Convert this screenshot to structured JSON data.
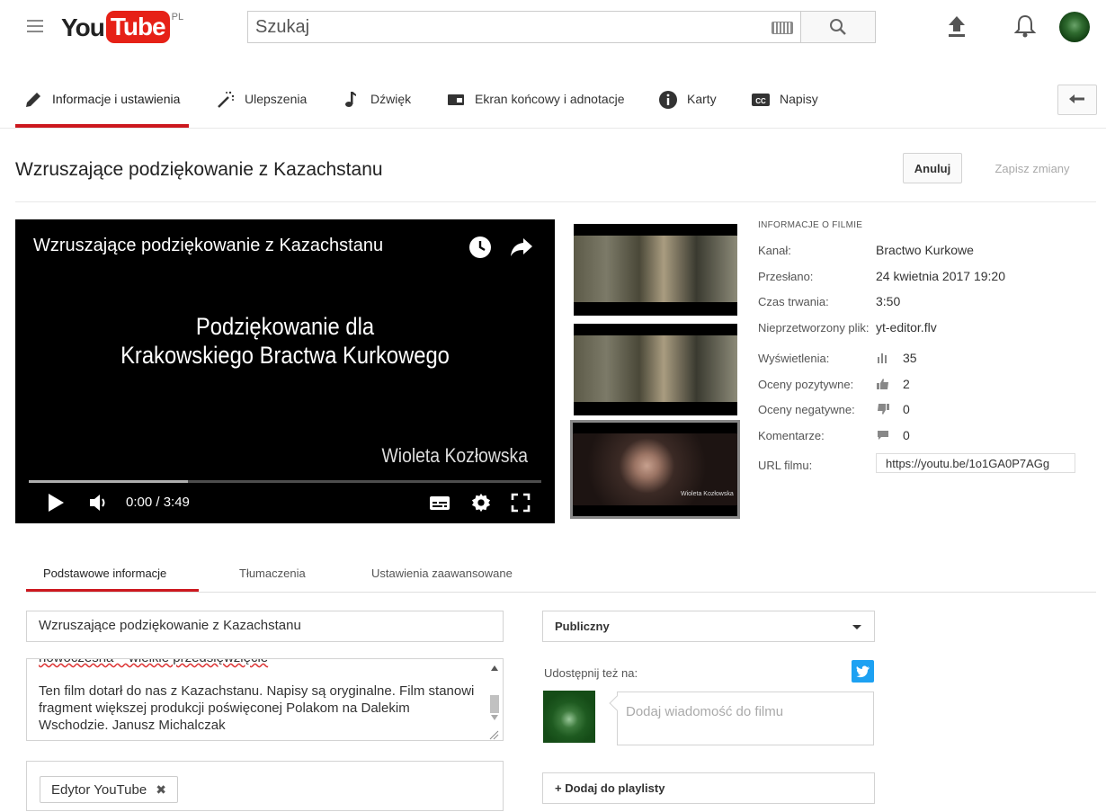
{
  "masthead": {
    "logo_you": "You",
    "logo_tube": "Tube",
    "country_code": "PL",
    "search_placeholder": "Szukaj",
    "brand_color": "#e62117"
  },
  "editor_tabs": [
    {
      "label": "Informacje i ustawienia",
      "icon": "pencil-icon",
      "active": true
    },
    {
      "label": "Ulepszenia",
      "icon": "magic-wand-icon"
    },
    {
      "label": "Dźwięk",
      "icon": "music-note-icon"
    },
    {
      "label": "Ekran końcowy i adnotacje",
      "icon": "end-screen-icon"
    },
    {
      "label": "Karty",
      "icon": "info-circle-icon"
    },
    {
      "label": "Napisy",
      "icon": "cc-icon"
    }
  ],
  "page": {
    "title": "Wzruszające podziękowanie z Kazachstanu",
    "cancel_label": "Anuluj",
    "save_label": "Zapisz zmiany",
    "accent_color": "#cc181e"
  },
  "player": {
    "title": "Wzruszające podziękowanie z Kazachstanu",
    "frame_line1": "Podziękowanie dla",
    "frame_line2": "Krakowskiego Bractwa Kurkowego",
    "frame_author": "Wioleta Kozłowska",
    "time_display": "0:00 / 3:49",
    "buffered_fraction": 0.31
  },
  "thumbnails": [
    {
      "name": "thumbnail-1",
      "selected": false
    },
    {
      "name": "thumbnail-2",
      "selected": false
    },
    {
      "name": "thumbnail-3",
      "selected": true,
      "caption": "Wioleta Kozłowska"
    }
  ],
  "info": {
    "heading": "INFORMACJE O FILMIE",
    "channel_label": "Kanał:",
    "channel": "Bractwo Kurkowe",
    "uploaded_label": "Przesłano:",
    "uploaded": "24 kwietnia 2017 19:20",
    "duration_label": "Czas trwania:",
    "duration": "3:50",
    "raw_file_label": "Nieprzetworzony plik:",
    "raw_file": "yt-editor.flv",
    "views_label": "Wyświetlenia:",
    "views": "35",
    "likes_label": "Oceny pozytywne:",
    "likes": "2",
    "dislikes_label": "Oceny negatywne:",
    "dislikes": "0",
    "comments_label": "Komentarze:",
    "comments": "0",
    "url_label": "URL filmu:",
    "url": "https://youtu.be/1o1GA0P7AGg"
  },
  "bottom_tabs": [
    {
      "label": "Podstawowe informacje",
      "active": true
    },
    {
      "label": "Tłumaczenia"
    },
    {
      "label": "Ustawienia zaawansowane"
    }
  ],
  "form": {
    "title_value": "Wzruszające podziękowanie z Kazachstanu",
    "description_cut_line": "nowoczesna – wielkie przedsięwzięcie",
    "description": "Ten film dotarł do nas z Kazachstanu. Napisy są oryginalne. Film stanowi fragment większej produkcji poświęconej Polakom na Dalekim Wschodzie. Janusz Michalczak",
    "tag": "Edytor YouTube",
    "privacy": "Publiczny",
    "share_label": "Udostępnij też na:",
    "share_placeholder": "Dodaj wiadomość do filmu",
    "playlist_label": "+ Dodaj do playlisty"
  }
}
